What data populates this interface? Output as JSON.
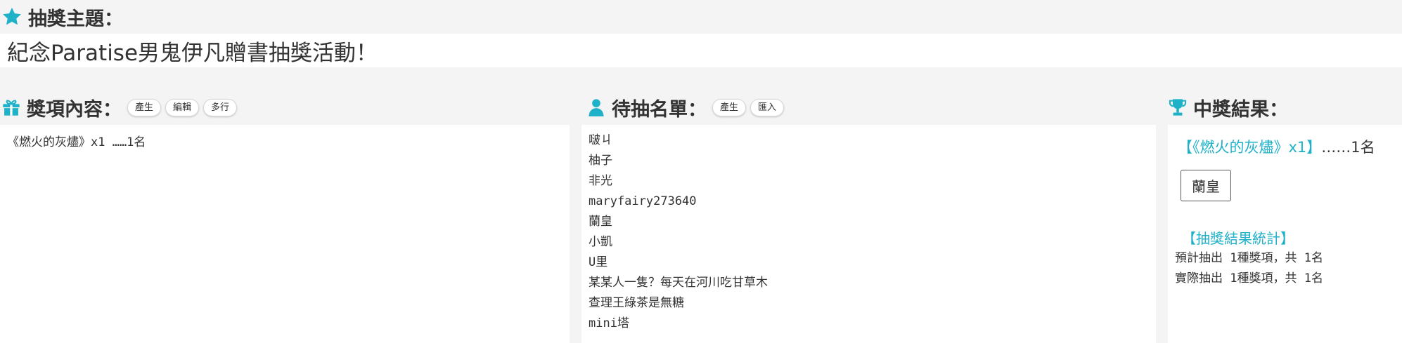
{
  "topic": {
    "label": "抽獎主題：",
    "value": "紀念Paratise男鬼伊凡贈書抽獎活動！",
    "icon": "star-icon"
  },
  "prizes": {
    "title": "獎項內容：",
    "icon": "gift-icon",
    "buttons": [
      "產生",
      "編輯",
      "多行"
    ],
    "content": "《燃火的灰燼》x1 ……1名"
  },
  "candidates": {
    "title": "待抽名單：",
    "icon": "user-icon",
    "buttons": [
      "產生",
      "匯入"
    ],
    "names": [
      "啵ㄐ",
      "柚子",
      "非光",
      "maryfairy273640",
      "蘭皇",
      "小凱",
      "U里",
      "某某人一隻？每天在河川吃甘草木",
      "查理王綠茶是無糖",
      "mini塔"
    ]
  },
  "results": {
    "title": "中獎結果：",
    "icon": "trophy-icon",
    "prize_label": "【《燃火的灰燼》x1】",
    "prize_count": "……1名",
    "winner": "蘭皇",
    "stats_title": "【抽獎結果統計】",
    "stats": [
      "預計抽出 1種獎項，共 1名",
      "實際抽出 1種獎項，共 1名"
    ]
  },
  "colors": {
    "accent": "#1fb1c8",
    "background": "#f4f4f4"
  }
}
